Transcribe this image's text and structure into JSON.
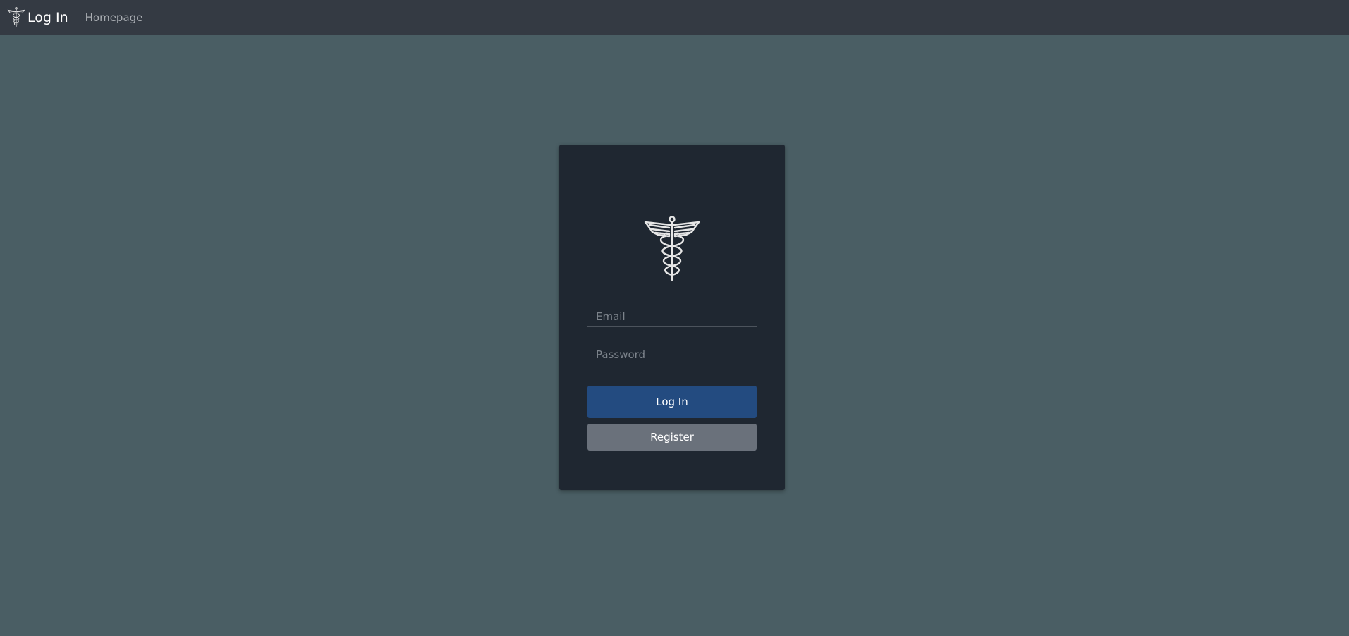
{
  "navbar": {
    "brand_label": "Log In",
    "links": [
      {
        "label": "Homepage"
      }
    ]
  },
  "login_form": {
    "email_placeholder": "Email",
    "password_placeholder": "Password",
    "login_label": "Log In",
    "register_label": "Register"
  },
  "icons": {
    "brand": "caduceus-icon",
    "card": "caduceus-icon"
  },
  "colors": {
    "background": "#4a5e64",
    "navbar": "#343a43",
    "card": "#1f2731",
    "primary": "#234b80",
    "secondary": "#6a717b"
  }
}
